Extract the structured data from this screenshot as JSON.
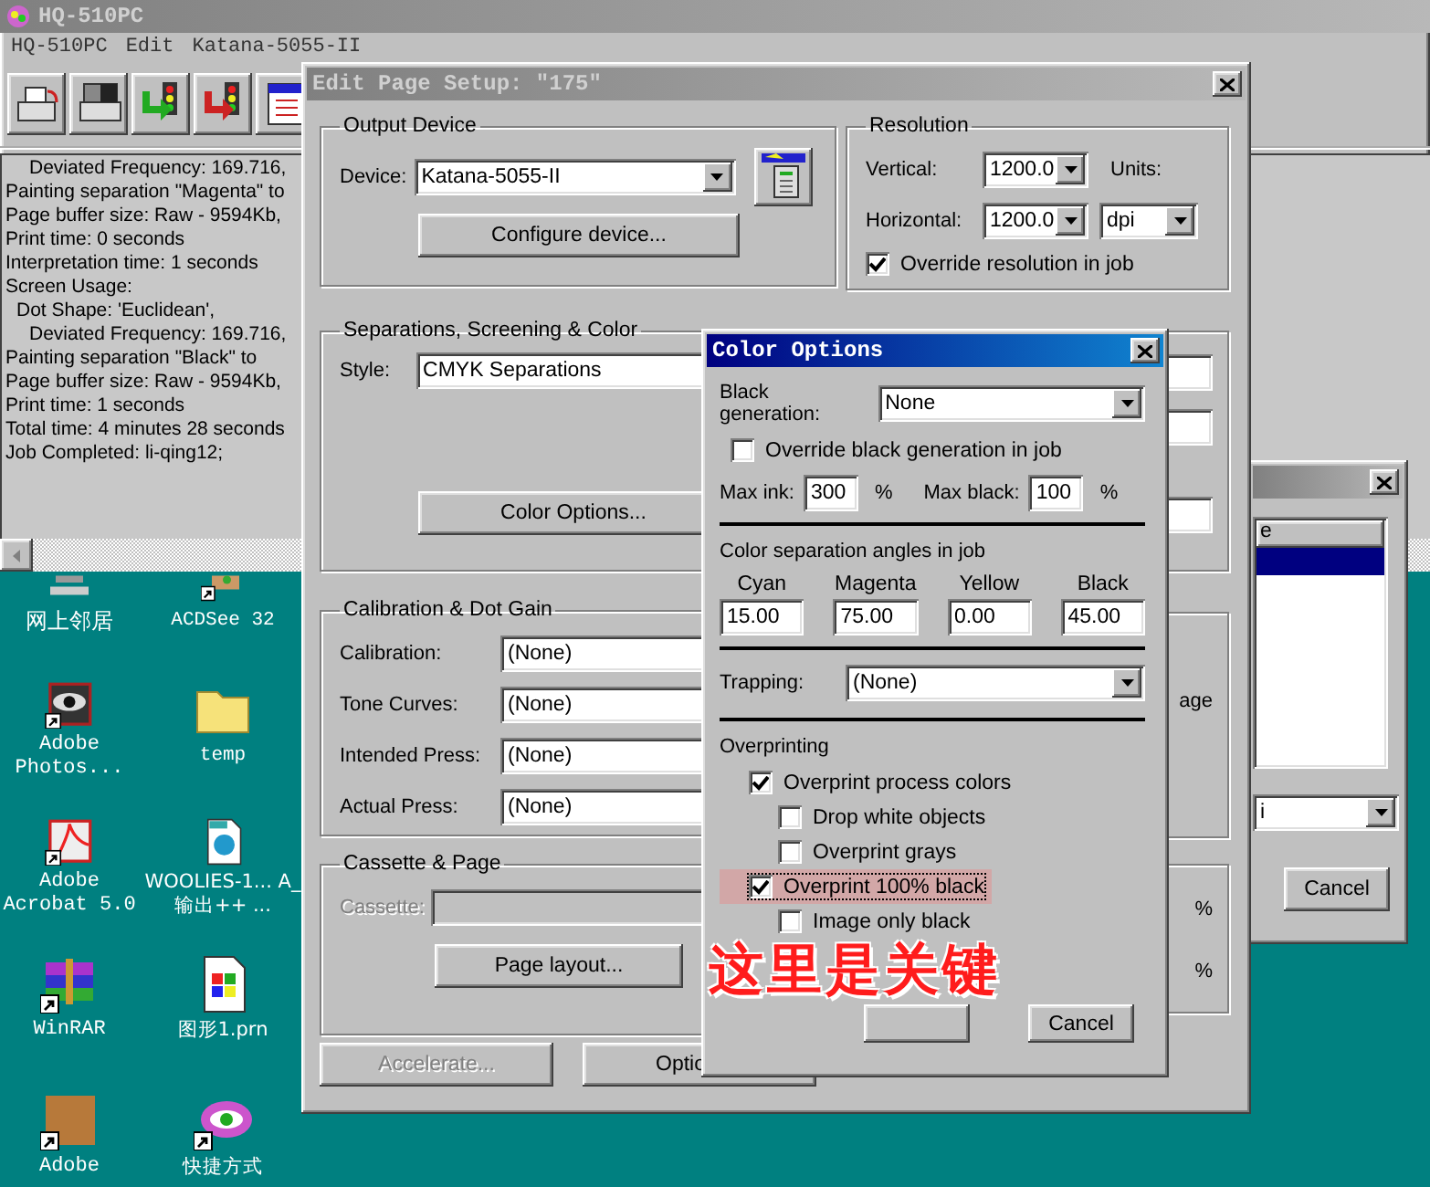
{
  "app_window": {
    "title": "HQ-510PC",
    "menu": [
      "HQ-510PC",
      "Edit",
      "Katana-5055-II"
    ],
    "log_lines": [
      {
        "kind": "subsub",
        "text": "Deviated Frequency: 169.716,"
      },
      {
        "kind": "plain",
        "text": "Painting separation \"Magenta\" to"
      },
      {
        "kind": "plain",
        "text": "Page buffer size: Raw - 9594Kb,"
      },
      {
        "kind": "plain",
        "text": "Print time: 0 seconds"
      },
      {
        "kind": "plain",
        "text": "Interpretation time: 1 seconds"
      },
      {
        "kind": "plain",
        "text": "Screen Usage:"
      },
      {
        "kind": "sub",
        "text": "Dot Shape: 'Euclidean',"
      },
      {
        "kind": "subsub",
        "text": "Deviated Frequency: 169.716,"
      },
      {
        "kind": "plain",
        "text": "Painting separation \"Black\" to"
      },
      {
        "kind": "plain",
        "text": "Page buffer size: Raw - 9594Kb,"
      },
      {
        "kind": "plain",
        "text": "Print time: 1 seconds"
      },
      {
        "kind": "plain",
        "text": "Total time: 4 minutes 28 seconds"
      },
      {
        "kind": "plain",
        "text": "Job Completed: li-qing12;"
      }
    ]
  },
  "desktop_icons": [
    {
      "label": "网上邻居",
      "kind": "network",
      "shortcut": false
    },
    {
      "label": "ACDSee 32",
      "kind": "viewer",
      "shortcut": true
    },
    {
      "label": "Adobe Photos...",
      "kind": "photoshop",
      "shortcut": true
    },
    {
      "label": "temp",
      "kind": "folder",
      "shortcut": false
    },
    {
      "label": "Adobe Acrobat 5.0",
      "kind": "acrobat",
      "shortcut": true
    },
    {
      "label": "WOOLIES-1... A_输出++ ...",
      "kind": "eps",
      "shortcut": false
    },
    {
      "label": "WinRAR",
      "kind": "archive",
      "shortcut": true
    },
    {
      "label": "图形1.prn",
      "kind": "prn",
      "shortcut": false
    },
    {
      "label": "Adobe",
      "kind": "painting",
      "shortcut": true
    },
    {
      "label": "快捷方式",
      "kind": "shortcut_eye",
      "shortcut": true
    }
  ],
  "page_setup": {
    "title": "Edit Page Setup: \"175\"",
    "output_device": {
      "heading": "Output Device",
      "device_label": "Device:",
      "device_value": "Katana-5055-II",
      "configure_button": "Configure device..."
    },
    "resolution": {
      "heading": "Resolution",
      "vertical_label": "Vertical:",
      "vertical_value": "1200.0",
      "units_label": "Units:",
      "horizontal_label": "Horizontal:",
      "horizontal_value": "1200.0",
      "units_value": "dpi",
      "override": {
        "label": "Override resolution in job",
        "checked": true
      }
    },
    "separations": {
      "heading": "Separations, Screening & Color",
      "style_label": "Style:",
      "style_value": "CMYK Separations",
      "color_options_button": "Color Options..."
    },
    "calibration": {
      "heading": "Calibration & Dot Gain",
      "rows": [
        {
          "label": "Calibration:",
          "value": "(None)"
        },
        {
          "label": "Tone Curves:",
          "value": "(None)"
        },
        {
          "label": "Intended Press:",
          "value": "(None)"
        },
        {
          "label": "Actual Press:",
          "value": "(None)"
        }
      ]
    },
    "right_fragment": "age",
    "right_marks": [
      "%",
      "%"
    ],
    "cassette": {
      "heading": "Cassette & Page",
      "cassette_label": "Cassette:",
      "cassette_disabled": true,
      "page_layout_button": "Page layout..."
    },
    "buttons": [
      {
        "label": "Accelerate...",
        "disabled": true
      },
      {
        "label": "Optio",
        "disabled": false
      }
    ]
  },
  "back_dialog": {
    "list_header": "e",
    "list_rows": [
      {
        "selected": true
      }
    ],
    "dropdown_value": "i",
    "cancel_button": "Cancel"
  },
  "color_options": {
    "title": "Color Options",
    "black_generation": {
      "label": "Black generation:",
      "value": "None"
    },
    "override_black": {
      "label": "Override black generation in job",
      "checked": false
    },
    "max_ink": {
      "label": "Max ink:",
      "value": "300",
      "unit": "%"
    },
    "max_black": {
      "label": "Max black:",
      "value": "100",
      "unit": "%"
    },
    "angles_heading": "Color separation angles in job",
    "angles": [
      {
        "label": "Cyan",
        "value": "15.00"
      },
      {
        "label": "Magenta",
        "value": "75.00"
      },
      {
        "label": "Yellow",
        "value": "0.00"
      },
      {
        "label": "Black",
        "value": "45.00"
      }
    ],
    "trapping": {
      "label": "Trapping:",
      "value": "(None)"
    },
    "overprinting_heading": "Overprinting",
    "overprint_options": [
      {
        "label": "Overprint process colors",
        "checked": true,
        "annotated": false,
        "children": [
          {
            "label": "Drop white objects",
            "checked": false,
            "annotated": false
          },
          {
            "label": "Overprint grays",
            "checked": false,
            "annotated": false
          }
        ]
      },
      {
        "label": "Overprint 100% black",
        "checked": true,
        "annotated": true,
        "children": [
          {
            "label": "Image only black",
            "checked": false,
            "annotated": false
          }
        ]
      }
    ],
    "cancel_button": "Cancel"
  },
  "annotation": {
    "text": "这里是关键"
  }
}
